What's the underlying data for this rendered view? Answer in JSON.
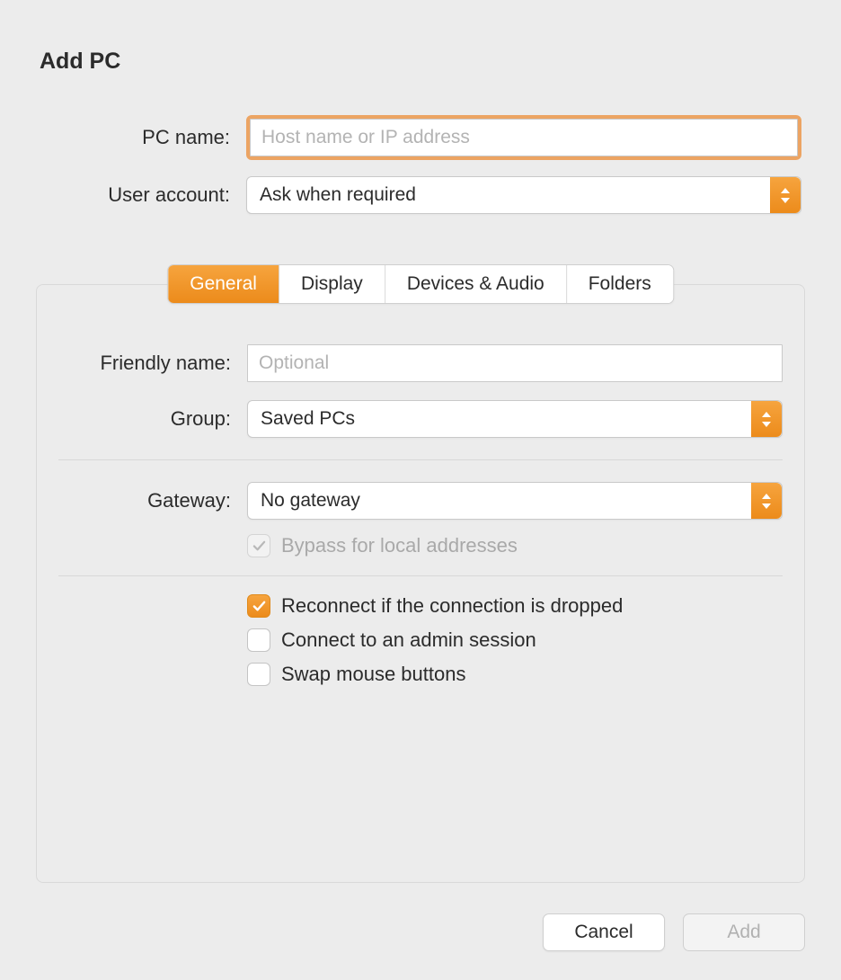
{
  "title": "Add PC",
  "form": {
    "pc_name_label": "PC name:",
    "pc_name_value": "",
    "pc_name_placeholder": "Host name or IP address",
    "user_account_label": "User account:",
    "user_account_value": "Ask when required"
  },
  "tabs": {
    "general": "General",
    "display": "Display",
    "devices": "Devices & Audio",
    "folders": "Folders"
  },
  "general": {
    "friendly_label": "Friendly name:",
    "friendly_value": "",
    "friendly_placeholder": "Optional",
    "group_label": "Group:",
    "group_value": "Saved PCs",
    "gateway_label": "Gateway:",
    "gateway_value": "No gateway",
    "bypass_label": "Bypass for local addresses",
    "reconnect_label": "Reconnect if the connection is dropped",
    "admin_label": "Connect to an admin session",
    "swap_label": "Swap mouse buttons"
  },
  "buttons": {
    "cancel": "Cancel",
    "add": "Add"
  }
}
